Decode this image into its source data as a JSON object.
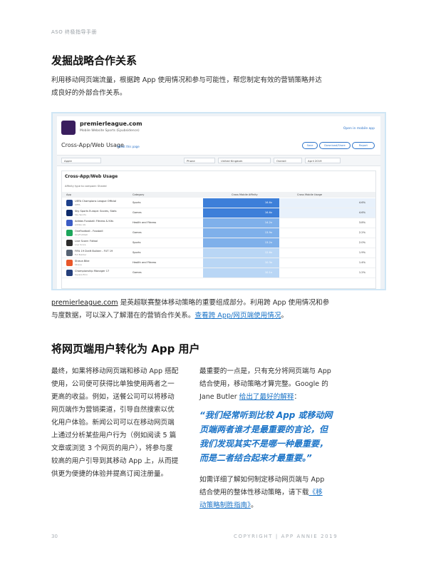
{
  "header": {
    "running_title": "ASO 终极指导手册"
  },
  "section1": {
    "heading": "发掘战略合作关系",
    "intro_line1": "利用移动网页端流量，根据跨 App 使用情况和参与可能性，帮您制定有效的营销策略并达",
    "intro_line2": "成良好的外部合作关系。"
  },
  "screenshot": {
    "site_name": "premierleague.com",
    "site_sub": "Mobile Website    Sports (Epubsidence)",
    "top_link": "Open in mobile app",
    "page_title": "Cross-App/Web Usage",
    "page_title_link": "About this page",
    "pills": [
      "Save",
      "Download/Share",
      "Report"
    ],
    "filters": [
      "Apple",
      "Phone",
      "United Kingdom",
      "Overall",
      "April 2019"
    ],
    "panel_title": "Cross-App/Web Usage",
    "panel_meta": "Affinity type to compare:  Shared",
    "columns": [
      "App",
      "Category",
      "Cross Mobile Affinity",
      "Cross Mobile Usage"
    ],
    "rows": [
      {
        "app": "UEFA Champions League Official",
        "sub": "UEFA",
        "category": "Sports",
        "aff": "16.6x",
        "usage": "4.6%",
        "icon_color": "#1d3f8a"
      },
      {
        "app": "Sky Sports Europe: Scores, Stats",
        "sub": "Sky Sports",
        "category": "Games",
        "aff": "16.6x",
        "usage": "4.6%",
        "icon_color": "#0d2a6b"
      },
      {
        "app": "Adidas Fussball: Fitness & Kits",
        "sub": "adidas AG",
        "category": "Health and Fitness",
        "aff": "14.2x",
        "usage": "3.8%",
        "icon_color": "#3b5cc4"
      },
      {
        "app": "OneFootball - Fussball",
        "sub": "OneFootball",
        "category": "Games",
        "aff": "13.9x",
        "usage": "2.2%",
        "icon_color": "#1ca55b"
      },
      {
        "app": "Live Score: Fútbol",
        "sub": "Live Score",
        "category": "Sports",
        "aff": "13.2x",
        "usage": "2.0%",
        "icon_color": "#2c2c2c"
      },
      {
        "app": "FIFA 19 Draft Builder - FUT 19",
        "sub": "Fut Builder",
        "category": "Sports",
        "aff": "12.6x",
        "usage": "1.9%",
        "icon_color": "#566273"
      },
      {
        "app": "Strava Bike",
        "sub": "Strava",
        "category": "Health and Fitness",
        "aff": "10.3x",
        "usage": "1.4%",
        "icon_color": "#e8572a"
      },
      {
        "app": "Championship Manager 17",
        "sub": "Square Enix",
        "category": "Games",
        "aff": "10.1x",
        "usage": "1.2%",
        "icon_color": "#243e7a"
      }
    ],
    "colors": {
      "frame": "#cfe6f5",
      "affinity_dark": "#3d7fd9",
      "affinity_mid": "#7fb0ea",
      "affinity_light": "#b9d6f5"
    }
  },
  "caption": {
    "link_site": "premierleague.com",
    "text1": " 是英超联赛整体移动策略的重要组成部分。利用跨 App 使用情况和参",
    "text2": "与度数据，可以深入了解潜在的营销合作关系。",
    "link_text": "查看跨 App/网页端使用情况",
    "end": "。"
  },
  "section2": {
    "heading": "将网页端用户转化为 App 用户",
    "left_lines": [
      "最终，如果将移动网页端和移动 App 搭配",
      "使用，公司便可获得比单独使用两者之一",
      "更高的收益。例如，送餐公司可以将移动",
      "网页端作为营销渠道，引导自然搜索以优",
      "化用户体验。新闻公司可以在移动网页端",
      "上通过分析某些用户行为（例如阅读 5 篇",
      "文章或浏览 3 个网页的用户），将参与度",
      "较高的用户引导到其移动 App 上，从而提",
      "供更为便捷的体验并提高订阅注册量。"
    ],
    "right_line1": "最重要的一点是，只有充分将网页端与 App",
    "right_line2": "结合使用，移动策略才算完整。Google 的",
    "right_line3_prefix": "Jane Butler ",
    "right_line3_link": "给出了最好的解释",
    "right_line3_suffix": "：",
    "quote_lines": [
      "“我们经常听到比较 App 或移动网",
      "页端两者谁才是最重要的言论，但",
      "我们发现其实不是哪一种最重要，",
      "而是二者结合起来才最重要。”"
    ],
    "closing_line1": "如需详细了解如何制定移动网页端与 App",
    "closing_line2_prefix": "结合使用的整体性移动策略，请下载",
    "closing_line2_link": "《移",
    "closing_line3_link": "动策略制胜指南》",
    "closing_line3_suffix": "。"
  },
  "footer": {
    "page_number": "30",
    "copyright": "COPYRIGHT  |  APP ANNIE 2019"
  }
}
